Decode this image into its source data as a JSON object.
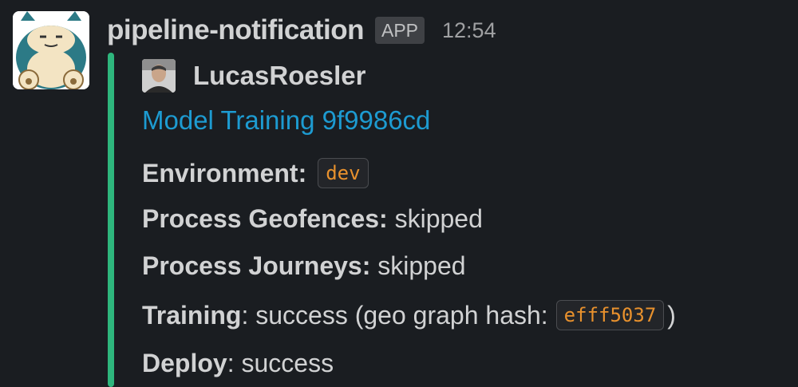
{
  "message": {
    "app_name": "pipeline-notification",
    "app_badge": "APP",
    "timestamp": "12:54",
    "attachment": {
      "author": "LucasRoesler",
      "title": "Model Training 9f9986cd",
      "bar_color": "#2eb67d",
      "fields": {
        "environment": {
          "label": "Environment:",
          "code": "dev"
        },
        "geofences": {
          "label": "Process Geofences:",
          "value": " skipped"
        },
        "journeys": {
          "label": "Process Journeys:",
          "value": " skipped"
        },
        "training": {
          "label": "Training",
          "value_before": ": success (geo graph hash:",
          "code": "efff5037",
          "value_after": ")"
        },
        "deploy": {
          "label": "Deploy",
          "value": ": success"
        }
      }
    }
  },
  "icons": {
    "app_avatar": "snorlax-avatar-icon",
    "author_avatar": "user-photo-icon"
  },
  "colors": {
    "background": "#1a1d21",
    "link": "#1d9bd1",
    "code_text": "#e8912d"
  }
}
